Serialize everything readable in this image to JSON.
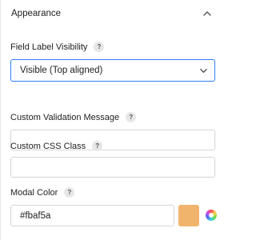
{
  "section": {
    "title": "Appearance"
  },
  "field_label_visibility": {
    "label": "Field Label Visibility",
    "help": "?",
    "selected": "Visible (Top aligned)"
  },
  "custom_validation_message": {
    "label": "Custom Validation Message",
    "help": "?",
    "value": ""
  },
  "custom_css_class": {
    "label": "Custom CSS Class",
    "help": "?",
    "value": ""
  },
  "modal_color": {
    "label": "Modal Color",
    "help": "?",
    "value": "#fbaf5a",
    "swatch_color": "#f0b46d"
  },
  "icons": {
    "collapse": "chevron-up-icon",
    "select": "chevron-down-icon",
    "help": "help-icon",
    "picker": "color-wheel-icon"
  }
}
